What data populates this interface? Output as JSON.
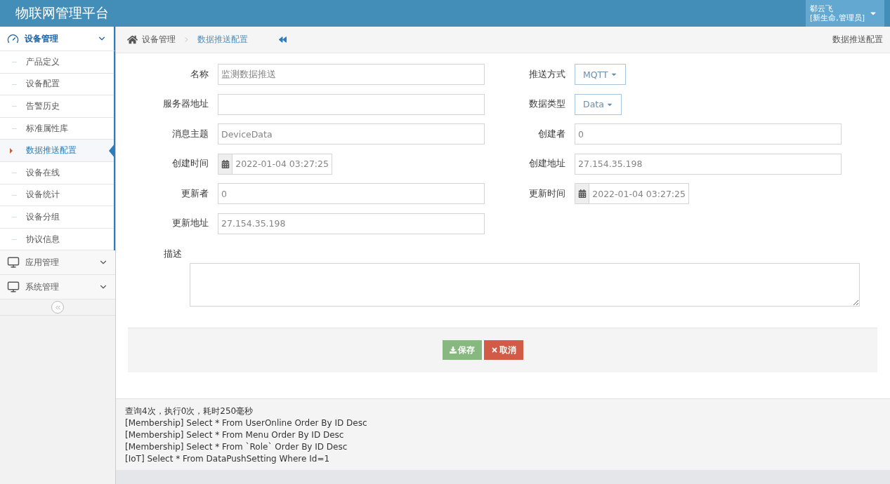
{
  "header": {
    "title": "物联网管理平台",
    "user": {
      "name": "郗云飞",
      "role": "[新生命,管理员]"
    }
  },
  "sidebar": {
    "groups": [
      {
        "label": "设备管理",
        "expanded": true,
        "children": [
          {
            "label": "产品定义",
            "selected": false
          },
          {
            "label": "设备配置",
            "selected": false
          },
          {
            "label": "告警历史",
            "selected": false
          },
          {
            "label": "标准属性库",
            "selected": false
          },
          {
            "label": "数据推送配置",
            "selected": true
          },
          {
            "label": "设备在线",
            "selected": false
          },
          {
            "label": "设备统计",
            "selected": false
          },
          {
            "label": "设备分组",
            "selected": false
          },
          {
            "label": "协议信息",
            "selected": false
          }
        ]
      },
      {
        "label": "应用管理",
        "expanded": false
      },
      {
        "label": "系统管理",
        "expanded": false
      }
    ]
  },
  "breadcrumb": {
    "items": [
      "设备管理",
      "数据推送配置"
    ],
    "page_title": "数据推送配置"
  },
  "form": {
    "columns": [
      [
        {
          "label": "名称",
          "kind": "text",
          "value": "监测数据推送"
        },
        {
          "label": "服务器地址",
          "kind": "text"
        },
        {
          "label": "消息主题",
          "kind": "text",
          "value": "DeviceData"
        },
        {
          "label": "创建时间",
          "kind": "date",
          "value": "2022-01-04 03:27:25"
        },
        {
          "label": "更新者",
          "kind": "text",
          "value": "0"
        },
        {
          "label": "更新地址",
          "kind": "text",
          "value": "27.154.35.198"
        }
      ],
      [
        {
          "label": "推送方式",
          "kind": "select",
          "value": "MQTT"
        },
        {
          "label": "数据类型",
          "kind": "select",
          "value": "Data"
        },
        {
          "label": "创建者",
          "kind": "text",
          "value": "0"
        },
        {
          "label": "创建地址",
          "kind": "text",
          "value": "27.154.35.198"
        },
        {
          "label": "更新时间",
          "kind": "date",
          "value": "2022-01-04 03:27:25"
        }
      ]
    ],
    "description": {
      "label": "描述"
    },
    "buttons": [
      {
        "label": "保存",
        "kind": "save"
      },
      {
        "label": "取消",
        "kind": "cancel"
      }
    ]
  },
  "log": [
    "查询4次，执行0次，耗时250毫秒",
    "[Membership] Select * From UserOnline Order By ID Desc",
    "[Membership] Select * From Menu Order By ID Desc",
    "[Membership] Select * From `Role` Order By ID Desc",
    "[IoT] Select * From DataPushSetting Where Id=1"
  ]
}
